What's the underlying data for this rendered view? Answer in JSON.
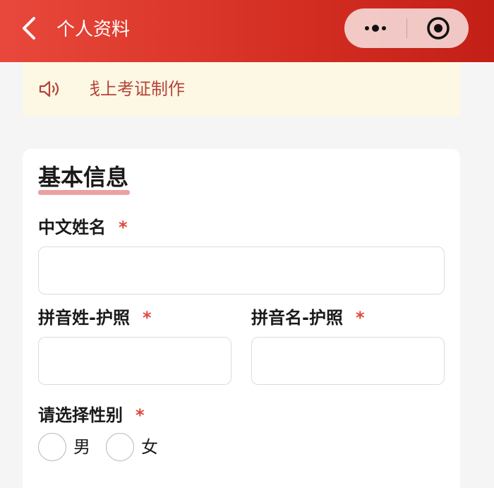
{
  "header": {
    "title": "个人资料",
    "background": "#d42e22"
  },
  "notice": {
    "text": "线上考证制作",
    "text_color": "#b5433a",
    "background": "#fdf8e4"
  },
  "form": {
    "section_title": "基本信息",
    "chinese_name": {
      "label": "中文姓名",
      "required_mark": "*",
      "value": "",
      "placeholder": ""
    },
    "pinyin_surname": {
      "label": "拼音姓-护照",
      "required_mark": "*",
      "value": "",
      "placeholder": ""
    },
    "pinyin_given_name": {
      "label": "拼音名-护照",
      "required_mark": "*",
      "value": "",
      "placeholder": ""
    },
    "gender": {
      "label": "请选择性别",
      "required_mark": "*",
      "options": [
        "男",
        "女"
      ],
      "selected": ""
    }
  },
  "colors": {
    "accent": "#e0463b",
    "underline": "#eba1a1"
  },
  "icons": {
    "back": "chevron-left-icon",
    "more": "more-dots-icon",
    "close": "target-circle-icon",
    "speaker": "speaker-icon"
  }
}
